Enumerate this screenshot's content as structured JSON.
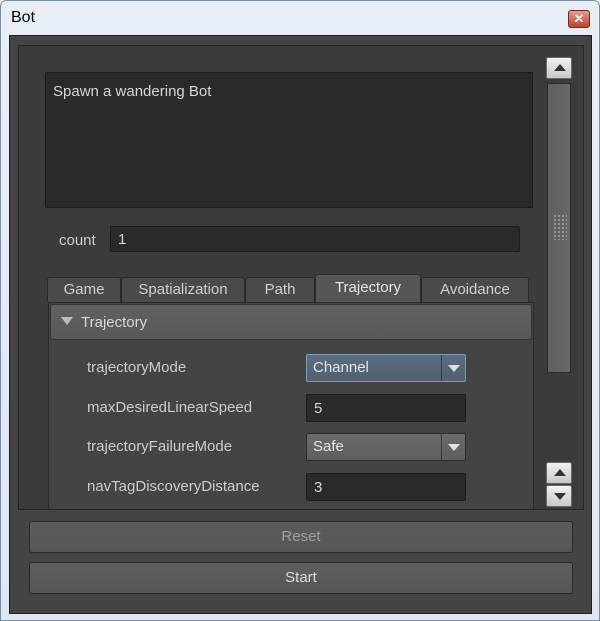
{
  "window": {
    "title": "Bot"
  },
  "description": "Spawn a wandering Bot",
  "count": {
    "label": "count",
    "value": "1"
  },
  "tabs": [
    {
      "label": "Game"
    },
    {
      "label": "Spatialization"
    },
    {
      "label": "Path"
    },
    {
      "label": "Trajectory",
      "active": true
    },
    {
      "label": "Avoidance"
    }
  ],
  "frame": {
    "title": "Trajectory"
  },
  "properties": [
    {
      "label": "trajectoryMode",
      "value": "Channel",
      "kind": "combo"
    },
    {
      "label": "maxDesiredLinearSpeed",
      "value": "5",
      "kind": "field"
    },
    {
      "label": "trajectoryFailureMode",
      "value": "Safe",
      "kind": "combo"
    },
    {
      "label": "navTagDiscoveryDistance",
      "value": "3",
      "kind": "field"
    }
  ],
  "buttons": {
    "reset": "Reset",
    "start": "Start"
  },
  "icons": {
    "close": "close-icon",
    "collapse": "triangle-down-icon",
    "dropdown": "chevron-down-icon",
    "scroll_up": "arrow-up-icon",
    "scroll_down": "arrow-down-icon"
  },
  "colors": {
    "panel": "#444444",
    "field": "#2a2a2a",
    "text": "#cccccc",
    "focus": "#7a9ab5"
  }
}
